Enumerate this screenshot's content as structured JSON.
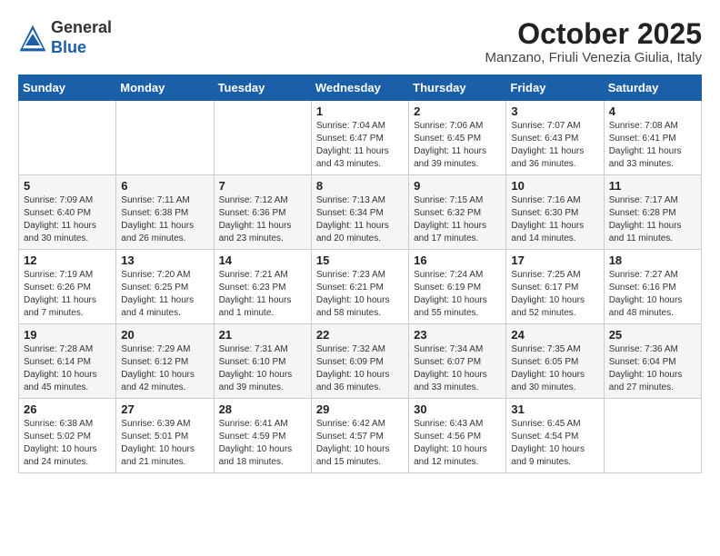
{
  "logo": {
    "general": "General",
    "blue": "Blue"
  },
  "title": "October 2025",
  "location": "Manzano, Friuli Venezia Giulia, Italy",
  "days_of_week": [
    "Sunday",
    "Monday",
    "Tuesday",
    "Wednesday",
    "Thursday",
    "Friday",
    "Saturday"
  ],
  "weeks": [
    [
      {
        "day": "",
        "info": ""
      },
      {
        "day": "",
        "info": ""
      },
      {
        "day": "",
        "info": ""
      },
      {
        "day": "1",
        "info": "Sunrise: 7:04 AM\nSunset: 6:47 PM\nDaylight: 11 hours\nand 43 minutes."
      },
      {
        "day": "2",
        "info": "Sunrise: 7:06 AM\nSunset: 6:45 PM\nDaylight: 11 hours\nand 39 minutes."
      },
      {
        "day": "3",
        "info": "Sunrise: 7:07 AM\nSunset: 6:43 PM\nDaylight: 11 hours\nand 36 minutes."
      },
      {
        "day": "4",
        "info": "Sunrise: 7:08 AM\nSunset: 6:41 PM\nDaylight: 11 hours\nand 33 minutes."
      }
    ],
    [
      {
        "day": "5",
        "info": "Sunrise: 7:09 AM\nSunset: 6:40 PM\nDaylight: 11 hours\nand 30 minutes."
      },
      {
        "day": "6",
        "info": "Sunrise: 7:11 AM\nSunset: 6:38 PM\nDaylight: 11 hours\nand 26 minutes."
      },
      {
        "day": "7",
        "info": "Sunrise: 7:12 AM\nSunset: 6:36 PM\nDaylight: 11 hours\nand 23 minutes."
      },
      {
        "day": "8",
        "info": "Sunrise: 7:13 AM\nSunset: 6:34 PM\nDaylight: 11 hours\nand 20 minutes."
      },
      {
        "day": "9",
        "info": "Sunrise: 7:15 AM\nSunset: 6:32 PM\nDaylight: 11 hours\nand 17 minutes."
      },
      {
        "day": "10",
        "info": "Sunrise: 7:16 AM\nSunset: 6:30 PM\nDaylight: 11 hours\nand 14 minutes."
      },
      {
        "day": "11",
        "info": "Sunrise: 7:17 AM\nSunset: 6:28 PM\nDaylight: 11 hours\nand 11 minutes."
      }
    ],
    [
      {
        "day": "12",
        "info": "Sunrise: 7:19 AM\nSunset: 6:26 PM\nDaylight: 11 hours\nand 7 minutes."
      },
      {
        "day": "13",
        "info": "Sunrise: 7:20 AM\nSunset: 6:25 PM\nDaylight: 11 hours\nand 4 minutes."
      },
      {
        "day": "14",
        "info": "Sunrise: 7:21 AM\nSunset: 6:23 PM\nDaylight: 11 hours\nand 1 minute."
      },
      {
        "day": "15",
        "info": "Sunrise: 7:23 AM\nSunset: 6:21 PM\nDaylight: 10 hours\nand 58 minutes."
      },
      {
        "day": "16",
        "info": "Sunrise: 7:24 AM\nSunset: 6:19 PM\nDaylight: 10 hours\nand 55 minutes."
      },
      {
        "day": "17",
        "info": "Sunrise: 7:25 AM\nSunset: 6:17 PM\nDaylight: 10 hours\nand 52 minutes."
      },
      {
        "day": "18",
        "info": "Sunrise: 7:27 AM\nSunset: 6:16 PM\nDaylight: 10 hours\nand 48 minutes."
      }
    ],
    [
      {
        "day": "19",
        "info": "Sunrise: 7:28 AM\nSunset: 6:14 PM\nDaylight: 10 hours\nand 45 minutes."
      },
      {
        "day": "20",
        "info": "Sunrise: 7:29 AM\nSunset: 6:12 PM\nDaylight: 10 hours\nand 42 minutes."
      },
      {
        "day": "21",
        "info": "Sunrise: 7:31 AM\nSunset: 6:10 PM\nDaylight: 10 hours\nand 39 minutes."
      },
      {
        "day": "22",
        "info": "Sunrise: 7:32 AM\nSunset: 6:09 PM\nDaylight: 10 hours\nand 36 minutes."
      },
      {
        "day": "23",
        "info": "Sunrise: 7:34 AM\nSunset: 6:07 PM\nDaylight: 10 hours\nand 33 minutes."
      },
      {
        "day": "24",
        "info": "Sunrise: 7:35 AM\nSunset: 6:05 PM\nDaylight: 10 hours\nand 30 minutes."
      },
      {
        "day": "25",
        "info": "Sunrise: 7:36 AM\nSunset: 6:04 PM\nDaylight: 10 hours\nand 27 minutes."
      }
    ],
    [
      {
        "day": "26",
        "info": "Sunrise: 6:38 AM\nSunset: 5:02 PM\nDaylight: 10 hours\nand 24 minutes."
      },
      {
        "day": "27",
        "info": "Sunrise: 6:39 AM\nSunset: 5:01 PM\nDaylight: 10 hours\nand 21 minutes."
      },
      {
        "day": "28",
        "info": "Sunrise: 6:41 AM\nSunset: 4:59 PM\nDaylight: 10 hours\nand 18 minutes."
      },
      {
        "day": "29",
        "info": "Sunrise: 6:42 AM\nSunset: 4:57 PM\nDaylight: 10 hours\nand 15 minutes."
      },
      {
        "day": "30",
        "info": "Sunrise: 6:43 AM\nSunset: 4:56 PM\nDaylight: 10 hours\nand 12 minutes."
      },
      {
        "day": "31",
        "info": "Sunrise: 6:45 AM\nSunset: 4:54 PM\nDaylight: 10 hours\nand 9 minutes."
      },
      {
        "day": "",
        "info": ""
      }
    ]
  ]
}
